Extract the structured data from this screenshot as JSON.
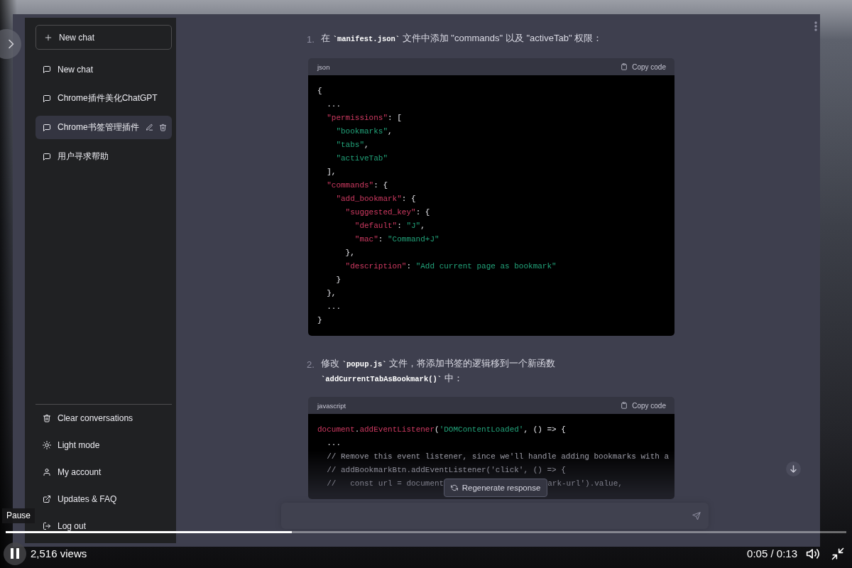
{
  "app": {
    "sidebar": {
      "new_chat_button": {
        "label": "New chat"
      },
      "conversations": [
        {
          "title": "New chat",
          "selected": false
        },
        {
          "title": "Chrome插件美化ChatGPT",
          "selected": false
        },
        {
          "title": "Chrome书签管理插件",
          "selected": true
        },
        {
          "title": "用户寻求帮助",
          "selected": false
        }
      ],
      "menu": [
        {
          "kind": "trash",
          "label": "Clear conversations"
        },
        {
          "kind": "sun",
          "label": "Light mode"
        },
        {
          "kind": "user",
          "label": "My account"
        },
        {
          "kind": "external",
          "label": "Updates & FAQ"
        },
        {
          "kind": "exit",
          "label": "Log out"
        }
      ]
    },
    "main": {
      "steps": [
        {
          "number": "1.",
          "parts": [
            {
              "kind": "text",
              "text": "在 "
            },
            {
              "kind": "code",
              "text": "`manifest.json`"
            },
            {
              "kind": "text",
              "text": " 文件中添加 \"commands\" 以及 \"activeTab\" 权限："
            }
          ],
          "code_block": {
            "language": "json",
            "copy_label": "Copy code",
            "lines": [
              {
                "tokens": [
                  {
                    "kind": "punct",
                    "text": "{"
                  }
                ]
              },
              {
                "tokens": [
                  {
                    "kind": "punct",
                    "text": "  ..."
                  }
                ]
              },
              {
                "tokens": [
                  {
                    "kind": "key",
                    "text": "  \"permissions\""
                  },
                  {
                    "kind": "punct",
                    "text": ": ["
                  }
                ]
              },
              {
                "tokens": [
                  {
                    "kind": "string",
                    "text": "    \"bookmarks\""
                  },
                  {
                    "kind": "punct",
                    "text": ","
                  }
                ]
              },
              {
                "tokens": [
                  {
                    "kind": "string",
                    "text": "    \"tabs\""
                  },
                  {
                    "kind": "punct",
                    "text": ","
                  }
                ]
              },
              {
                "tokens": [
                  {
                    "kind": "string",
                    "text": "    \"activeTab\""
                  }
                ]
              },
              {
                "tokens": [
                  {
                    "kind": "punct",
                    "text": "  ],"
                  }
                ]
              },
              {
                "tokens": [
                  {
                    "kind": "key",
                    "text": "  \"commands\""
                  },
                  {
                    "kind": "punct",
                    "text": ": {"
                  }
                ]
              },
              {
                "tokens": [
                  {
                    "kind": "key",
                    "text": "    \"add_bookmark\""
                  },
                  {
                    "kind": "punct",
                    "text": ": {"
                  }
                ]
              },
              {
                "tokens": [
                  {
                    "kind": "key",
                    "text": "      \"suggested_key\""
                  },
                  {
                    "kind": "punct",
                    "text": ": {"
                  }
                ]
              },
              {
                "tokens": [
                  {
                    "kind": "key",
                    "text": "        \"default\""
                  },
                  {
                    "kind": "punct",
                    "text": ": "
                  },
                  {
                    "kind": "string",
                    "text": "\"J\""
                  },
                  {
                    "kind": "punct",
                    "text": ","
                  }
                ]
              },
              {
                "tokens": [
                  {
                    "kind": "key",
                    "text": "        \"mac\""
                  },
                  {
                    "kind": "punct",
                    "text": ": "
                  },
                  {
                    "kind": "string",
                    "text": "\"Command+J\""
                  }
                ]
              },
              {
                "tokens": [
                  {
                    "kind": "punct",
                    "text": "      },"
                  }
                ]
              },
              {
                "tokens": [
                  {
                    "kind": "key",
                    "text": "      \"description\""
                  },
                  {
                    "kind": "punct",
                    "text": ": "
                  },
                  {
                    "kind": "string",
                    "text": "\"Add current page as bookmark\""
                  }
                ]
              },
              {
                "tokens": [
                  {
                    "kind": "punct",
                    "text": "    }"
                  }
                ]
              },
              {
                "tokens": [
                  {
                    "kind": "punct",
                    "text": "  },"
                  }
                ]
              },
              {
                "tokens": [
                  {
                    "kind": "punct",
                    "text": "  ..."
                  }
                ]
              },
              {
                "tokens": [
                  {
                    "kind": "punct",
                    "text": "}"
                  }
                ]
              }
            ]
          }
        },
        {
          "number": "2.",
          "parts": [
            {
              "kind": "text",
              "text": "修改 "
            },
            {
              "kind": "code",
              "text": "`popup.js`"
            },
            {
              "kind": "text",
              "text": " 文件，将添加书签的逻辑移到一个新函数 "
            },
            {
              "kind": "code",
              "text": "`addCurrentTabAsBookmark()`"
            },
            {
              "kind": "text",
              "text": " 中："
            }
          ],
          "code_block": {
            "language": "javascript",
            "copy_label": "Copy code",
            "lines": [
              {
                "tokens": [
                  {
                    "kind": "key",
                    "text": "document"
                  },
                  {
                    "kind": "punct",
                    "text": "."
                  },
                  {
                    "kind": "key",
                    "text": "addEventListener"
                  },
                  {
                    "kind": "punct",
                    "text": "("
                  },
                  {
                    "kind": "string",
                    "text": "'DOMContentLoaded'"
                  },
                  {
                    "kind": "punct",
                    "text": ", () => {"
                  }
                ]
              },
              {
                "tokens": [
                  {
                    "kind": "punct",
                    "text": "  ..."
                  }
                ]
              },
              {
                "tokens": [
                  {
                    "kind": "comment",
                    "text": "  // Remove this event listener, since we'll handle adding bookmarks with a"
                  }
                ]
              },
              {
                "tokens": [
                  {
                    "kind": "comment",
                    "text": "  // addBookmarkBtn.addEventListener('click', () => {"
                  }
                ]
              },
              {
                "tokens": [
                  {
                    "kind": "comment",
                    "text": "  //   const url = document"
                  }
                ],
                "after_cover": [
                  {
                    "kind": "comment",
                    "text": "ark-url').value,"
                  }
                ]
              }
            ]
          }
        }
      ],
      "regenerate_button": {
        "label": "Regenerate response"
      }
    }
  },
  "player": {
    "tooltip": "Pause",
    "playing": true,
    "progress": {
      "level": 0.34
    },
    "views": "2,516 views",
    "time": "0:05 / 0:13"
  }
}
